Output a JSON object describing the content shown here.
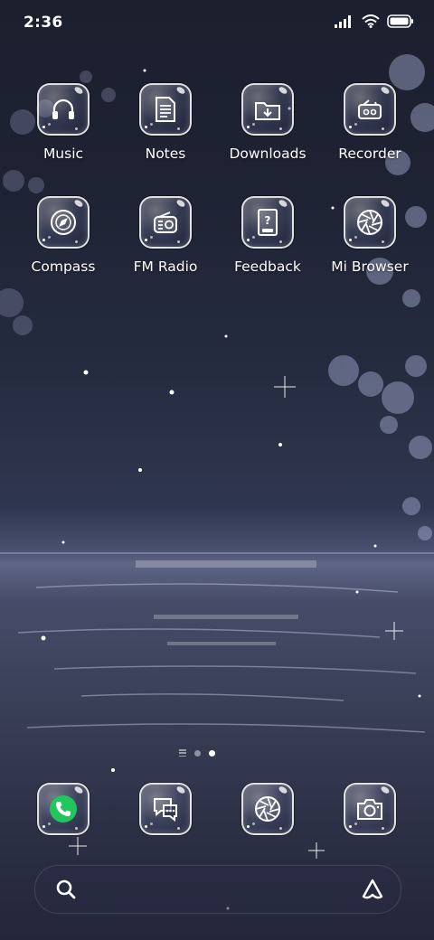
{
  "status_bar": {
    "time": "2:36"
  },
  "apps": [
    {
      "label": "Music",
      "icon": "headphones-icon"
    },
    {
      "label": "Notes",
      "icon": "notes-icon"
    },
    {
      "label": "Downloads",
      "icon": "download-folder-icon"
    },
    {
      "label": "Recorder",
      "icon": "recorder-icon"
    },
    {
      "label": "Compass",
      "icon": "compass-icon"
    },
    {
      "label": "FM Radio",
      "icon": "radio-icon"
    },
    {
      "label": "Feedback",
      "icon": "feedback-icon"
    },
    {
      "label": "Mi Browser",
      "icon": "browser-aperture-icon"
    }
  ],
  "dock": [
    {
      "name": "phone",
      "icon": "phone-icon"
    },
    {
      "name": "messages",
      "icon": "messages-icon"
    },
    {
      "name": "browser",
      "icon": "browser-aperture-icon"
    },
    {
      "name": "camera",
      "icon": "camera-icon"
    }
  ],
  "page_indicator": {
    "pages": 2,
    "active": 2
  },
  "search_bar": {
    "icon": "search-icon",
    "assistant_icon": "assistant-icon"
  },
  "colors": {
    "phone_green": "#22c55e",
    "icon_stroke": "#ffffff"
  }
}
